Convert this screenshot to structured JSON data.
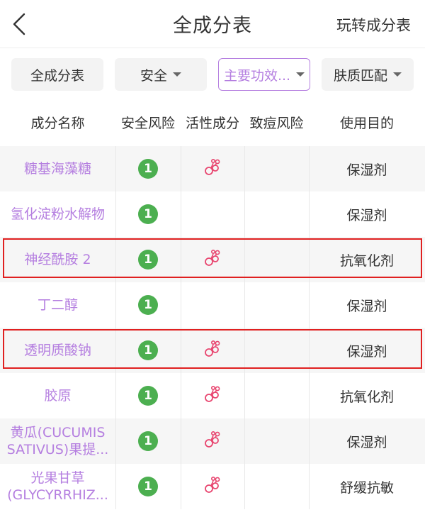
{
  "nav": {
    "title": "全成分表",
    "action": "玩转成分表"
  },
  "filters": [
    {
      "label": "全成分表",
      "caret": false,
      "active": false
    },
    {
      "label": "安全",
      "caret": true,
      "active": false
    },
    {
      "label": "主要功效...",
      "caret": true,
      "active": true
    },
    {
      "label": "肤质匹配",
      "caret": true,
      "active": false
    }
  ],
  "table": {
    "headers": [
      "成分名称",
      "安全风险",
      "活性成分",
      "致痘风险",
      "使用目的"
    ],
    "rows": [
      {
        "name": "糖基海藻糖",
        "risk": "1",
        "active": true,
        "purpose": "保湿剂"
      },
      {
        "name": "氢化淀粉水解物",
        "risk": "1",
        "active": false,
        "purpose": "保湿剂"
      },
      {
        "name": "神经酰胺 2",
        "risk": "1",
        "active": true,
        "purpose": "抗氧化剂"
      },
      {
        "name": "丁二醇",
        "risk": "1",
        "active": false,
        "purpose": "保湿剂"
      },
      {
        "name": "透明质酸钠",
        "risk": "1",
        "active": true,
        "purpose": "保湿剂"
      },
      {
        "name": "胶原",
        "risk": "1",
        "active": true,
        "purpose": "抗氧化剂"
      },
      {
        "name": "黄瓜(CUCUMIS SATIVUS)果提...",
        "risk": "1",
        "active": true,
        "purpose": "保湿剂"
      },
      {
        "name": "光果甘草 (GLYCYRRHIZ...",
        "risk": "1",
        "active": true,
        "purpose": "舒缓抗敏"
      }
    ]
  },
  "colors": {
    "accent": "#b57fe0",
    "safe_badge": "#4caf50",
    "active_icon": "#e8456f",
    "highlight": "#e02020"
  },
  "icons": {
    "back": "chevron-left-icon",
    "active": "cherry-molecule-icon"
  }
}
